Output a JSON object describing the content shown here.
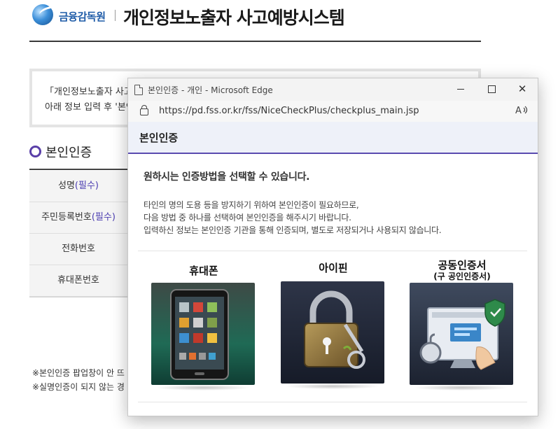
{
  "header": {
    "org_name": "금융감독원",
    "site_title": "개인정보노출자 사고예방시스템"
  },
  "notice": {
    "line1": "「개인정보노출자 사고",
    "line2": "아래 정보 입력 후 '본인"
  },
  "section": {
    "title": "본인인증"
  },
  "form": {
    "fields": [
      {
        "label": "성명",
        "required": "(필수)"
      },
      {
        "label": "주민등록번호",
        "required": "(필수)"
      },
      {
        "label": "전화번호",
        "required": ""
      },
      {
        "label": "휴대폰번호",
        "required": ""
      }
    ]
  },
  "footnotes": [
    "※본인인증 팝업창이 안 뜨",
    "※실명인증이 되지 않는 경"
  ],
  "popup": {
    "window_title": "본인인증 - 개인 - Microsoft Edge",
    "url": "https://pd.fss.or.kr/fss/NiceCheckPlus/checkplus_main.jsp",
    "read_aloud_label": "A⁾",
    "controls": {
      "minimize": "—",
      "maximize": "☐",
      "close": "✕"
    },
    "heading": "본인인증",
    "lead": "원하시는 인증방법을 선택할 수 있습니다.",
    "desc": [
      "타인의 명의 도용 등을 방지하기 위하여 본인인증이 필요하므로,",
      "다음 방법 중 하나를 선택하여 본인인증을 해주시기 바랍니다.",
      "입력하신 정보는 본인인증 기관을 통해 인증되며, 별도로 저장되거나 사용되지 않습니다."
    ],
    "options": [
      {
        "label": "휴대폰",
        "sub": "",
        "icon": "mobile-phone-icon"
      },
      {
        "label": "아이핀",
        "sub": "",
        "icon": "padlock-key-icon"
      },
      {
        "label": "공동인증서",
        "sub": "(구 공인인증서)",
        "icon": "certificate-monitor-icon"
      }
    ]
  },
  "colors": {
    "accent": "#5a4bb0",
    "required": "#4a3cb0",
    "header_bg": "#eef1f9",
    "brand_blue": "#1f5ca8"
  }
}
